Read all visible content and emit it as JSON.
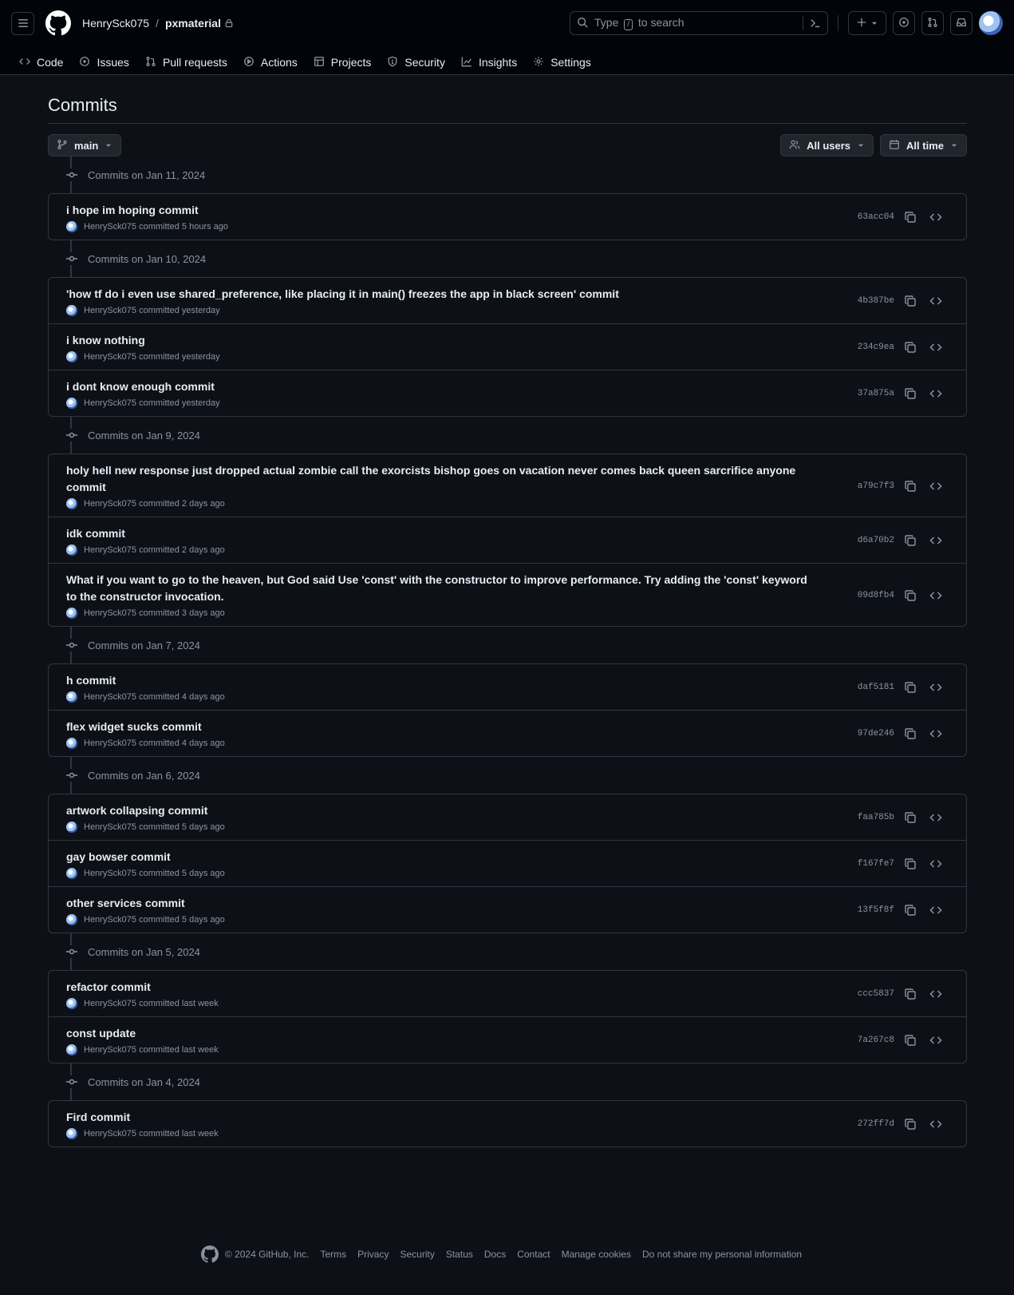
{
  "header": {
    "owner": "HenrySck075",
    "separator": "/",
    "repo": "pxmaterial",
    "search_before": "Type",
    "search_key": "/",
    "search_after": "to search"
  },
  "tabs": [
    {
      "label": "Code",
      "icon": "code-icon"
    },
    {
      "label": "Issues",
      "icon": "issue-icon"
    },
    {
      "label": "Pull requests",
      "icon": "pull-request-icon"
    },
    {
      "label": "Actions",
      "icon": "play-icon"
    },
    {
      "label": "Projects",
      "icon": "table-icon"
    },
    {
      "label": "Security",
      "icon": "shield-icon"
    },
    {
      "label": "Insights",
      "icon": "graph-icon"
    },
    {
      "label": "Settings",
      "icon": "gear-icon"
    }
  ],
  "page": {
    "title": "Commits",
    "branch": "main",
    "users_filter": "All users",
    "time_filter": "All time"
  },
  "groups": [
    {
      "date": "Commits on Jan 11, 2024",
      "commits": [
        {
          "title": "i hope im hoping commit",
          "author": "HenrySck075",
          "verb": "committed",
          "when": "5 hours ago",
          "sha": "63acc04"
        }
      ]
    },
    {
      "date": "Commits on Jan 10, 2024",
      "commits": [
        {
          "title": "'how tf do i even use shared_preference, like placing it in main() freezes the app in black screen' commit",
          "author": "HenrySck075",
          "verb": "committed",
          "when": "yesterday",
          "sha": "4b387be"
        },
        {
          "title": "i know nothing",
          "author": "HenrySck075",
          "verb": "committed",
          "when": "yesterday",
          "sha": "234c9ea"
        },
        {
          "title": "i dont know enough commit",
          "author": "HenrySck075",
          "verb": "committed",
          "when": "yesterday",
          "sha": "37a875a"
        }
      ]
    },
    {
      "date": "Commits on Jan 9, 2024",
      "commits": [
        {
          "title": "holy hell new response just dropped actual zombie call the exorcists bishop goes on vacation never comes back queen sarcrifice anyone commit",
          "author": "HenrySck075",
          "verb": "committed",
          "when": "2 days ago",
          "sha": "a79c7f3"
        },
        {
          "title": "idk commit",
          "author": "HenrySck075",
          "verb": "committed",
          "when": "2 days ago",
          "sha": "d6a70b2"
        },
        {
          "title": "What if you want to go to the heaven, but God said Use 'const' with the constructor to improve performance. Try adding the 'const' keyword to the constructor invocation.",
          "author": "HenrySck075",
          "verb": "committed",
          "when": "3 days ago",
          "sha": "09d8fb4"
        }
      ]
    },
    {
      "date": "Commits on Jan 7, 2024",
      "commits": [
        {
          "title": "h commit",
          "author": "HenrySck075",
          "verb": "committed",
          "when": "4 days ago",
          "sha": "daf5181"
        },
        {
          "title": "flex widget sucks commit",
          "author": "HenrySck075",
          "verb": "committed",
          "when": "4 days ago",
          "sha": "97de246"
        }
      ]
    },
    {
      "date": "Commits on Jan 6, 2024",
      "commits": [
        {
          "title": "artwork collapsing commit",
          "author": "HenrySck075",
          "verb": "committed",
          "when": "5 days ago",
          "sha": "faa785b"
        },
        {
          "title": "gay bowser commit",
          "author": "HenrySck075",
          "verb": "committed",
          "when": "5 days ago",
          "sha": "f167fe7"
        },
        {
          "title": "other services commit",
          "author": "HenrySck075",
          "verb": "committed",
          "when": "5 days ago",
          "sha": "13f5f8f"
        }
      ]
    },
    {
      "date": "Commits on Jan 5, 2024",
      "commits": [
        {
          "title": "refactor commit",
          "author": "HenrySck075",
          "verb": "committed",
          "when": "last week",
          "sha": "ccc5837"
        },
        {
          "title": "const update",
          "author": "HenrySck075",
          "verb": "committed",
          "when": "last week",
          "sha": "7a267c8"
        }
      ]
    },
    {
      "date": "Commits on Jan 4, 2024",
      "commits": [
        {
          "title": "Fird commit",
          "author": "HenrySck075",
          "verb": "committed",
          "when": "last week",
          "sha": "272ff7d"
        }
      ]
    }
  ],
  "footer": {
    "copyright": "© 2024 GitHub, Inc.",
    "links": [
      "Terms",
      "Privacy",
      "Security",
      "Status",
      "Docs",
      "Contact",
      "Manage cookies",
      "Do not share my personal information"
    ]
  },
  "colors": {
    "background": "#0d1117",
    "header": "#010409",
    "border": "#30363d",
    "muted": "#8b949e",
    "text": "#e6edf3"
  }
}
